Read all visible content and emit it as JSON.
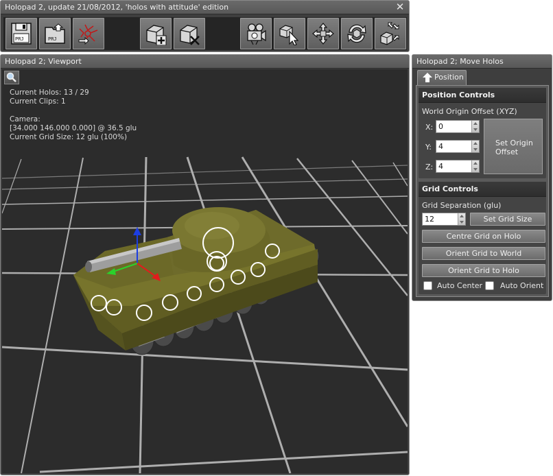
{
  "top_window": {
    "title": "Holopad 2, update 21/08/2012, 'holos with attitude' edition",
    "close_icon": "close-icon",
    "toolbar": [
      {
        "icon": "save-project-icon",
        "label": "PRJ"
      },
      {
        "icon": "open-project-icon",
        "label": "PRJ"
      },
      {
        "icon": "export-icon"
      },
      {
        "icon": "add-holo-icon"
      },
      {
        "icon": "delete-holo-icon"
      },
      {
        "icon": "camera-mode-icon"
      },
      {
        "icon": "select-mode-icon"
      },
      {
        "icon": "move-mode-icon"
      },
      {
        "icon": "rotate-mode-icon"
      },
      {
        "icon": "scale-mode-icon"
      }
    ]
  },
  "viewport": {
    "title": "Holopad 2; Viewport",
    "zoom_icon": "magnifier-icon",
    "info": {
      "holos": "Current Holos: 13 / 29",
      "clips": "Current Clips: 1",
      "camera_label": "Camera:",
      "camera_value": "[34.000 146.000 0.000] @ 36.5 glu",
      "grid": "Current Grid Size: 12 glu (100%)"
    },
    "colors": {
      "background": "#2c2c2c",
      "grid": "#bdbdbd",
      "tank": "#6e6b2a",
      "axis_x": "#e21c1c",
      "axis_y": "#2bd12b",
      "axis_z": "#1c3ee2"
    }
  },
  "move_holos": {
    "title": "Holopad 2; Move Holos",
    "tab_label": "Position",
    "tab_icon": "up-arrow-icon",
    "position_controls": {
      "header": "Position Controls",
      "offset_label": "World Origin Offset (XYZ)",
      "x_label": "X:",
      "x_value": "0",
      "y_label": "Y:",
      "y_value": "4",
      "z_label": "Z:",
      "z_value": "4",
      "set_origin_button": "Set Origin Offset"
    },
    "grid_controls": {
      "header": "Grid Controls",
      "separation_label": "Grid Separation (glu)",
      "separation_value": "12",
      "set_grid_button": "Set Grid Size",
      "centre_button": "Centre Grid on Holo",
      "orient_world_button": "Orient Grid to World",
      "orient_holo_button": "Orient Grid to Holo",
      "auto_center_label": "Auto Center",
      "auto_center_checked": false,
      "auto_orient_label": "Auto Orient",
      "auto_orient_checked": false
    }
  }
}
